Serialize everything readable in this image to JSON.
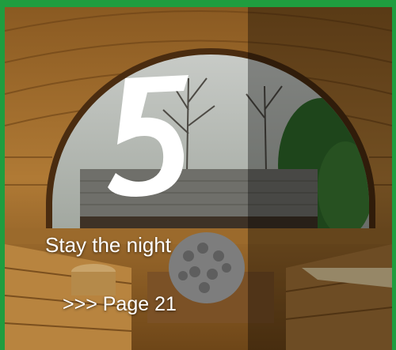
{
  "card": {
    "number": "5",
    "title": "Stay the night",
    "link_label": ">>> Page 21"
  },
  "colors": {
    "border": "#1f9d3f",
    "text": "#ffffff",
    "wood": "#a8732e"
  },
  "image": {
    "subject": "sauna-interior-with-window-view"
  }
}
